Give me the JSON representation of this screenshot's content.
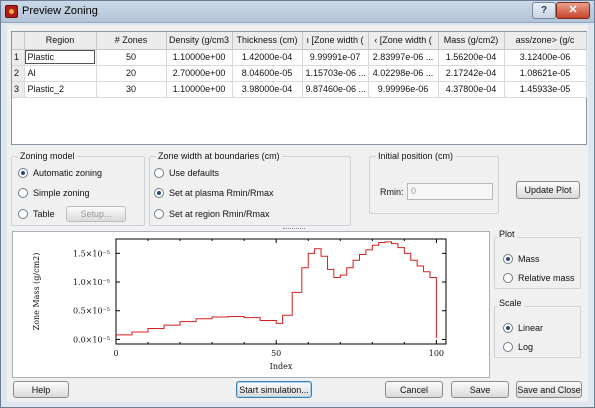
{
  "window": {
    "title": "Preview Zoning",
    "help_label": "?",
    "close_label": "✕"
  },
  "table": {
    "columns": [
      "Region",
      "# Zones",
      "Density (g/cm3)",
      "Thickness (cm)",
      "Min [Zone width (cm)]",
      "Max [Zone width (cm)]",
      "Mass (g/cm2)",
      "Mass/zone> (g/cm2)"
    ],
    "column_display": [
      "Region",
      "# Zones",
      "Density (g/cm3",
      "Thickness (cm)",
      "ı [Zone width (",
      "‹ [Zone width (",
      "Mass (g/cm2)",
      "ass/zone> (g/c"
    ],
    "rows": [
      {
        "index": "1",
        "cells": [
          "Plastic",
          "50",
          "1.10000e+00",
          "1.42000e-04",
          "9.99991e-07",
          "2.83997e-06 ...",
          "1.56200e-04",
          "3.12400e-06"
        ]
      },
      {
        "index": "2",
        "cells": [
          "Al",
          "20",
          "2.70000e+00",
          "8.04600e-05",
          "1.15703e-06 ...",
          "4.02298e-06 ...",
          "2.17242e-04",
          "1.08621e-05"
        ]
      },
      {
        "index": "3",
        "cells": [
          "Plastic_2",
          "30",
          "1.10000e+00",
          "3.98000e-04",
          "9.87460e-06 ...",
          "9.99996e-06",
          "4.37800e-04",
          "1.45933e-05"
        ]
      }
    ]
  },
  "zoning_model": {
    "label": "Zoning model",
    "options": [
      "Automatic zoning",
      "Simple zoning",
      "Table"
    ],
    "selected": "Automatic zoning",
    "setup_label": "Setup..."
  },
  "zone_width": {
    "label": "Zone width at boundaries (cm)",
    "options": [
      "Use defaults",
      "Set at plasma Rmin/Rmax",
      "Set at region Rmin/Rmax"
    ],
    "selected": "Set at plasma Rmin/Rmax"
  },
  "initial_position": {
    "label": "Initial position (cm)",
    "rmin_label": "Rmin:",
    "rmin_value": "0"
  },
  "update_plot_label": "Update Plot",
  "plot_panel": {
    "label": "Plot",
    "options": [
      "Mass",
      "Relative mass"
    ],
    "selected": "Mass"
  },
  "scale_panel": {
    "label": "Scale",
    "options": [
      "Linear",
      "Log"
    ],
    "selected": "Linear"
  },
  "buttons": {
    "help": "Help",
    "start": "Start simulation...",
    "cancel": "Cancel",
    "save": "Save",
    "save_close": "Save and Close"
  },
  "chart_data": {
    "type": "line",
    "xlabel": "Index",
    "ylabel": "Zone Mass (g/cm2)",
    "xlim": [
      0,
      103
    ],
    "ylim": [
      -8e-07,
      1.75e-05
    ],
    "xticks": [
      0,
      50,
      100
    ],
    "yticks": [
      0.0,
      5e-06,
      1e-05,
      1.5e-05
    ],
    "ytick_labels": [
      "0.0×10⁻⁵",
      "0.5×10⁻⁵",
      "1.0×10⁻⁵",
      "1.5×10⁻⁵"
    ],
    "line_color": "#d42020",
    "series": [
      {
        "step": true,
        "x": [
          0,
          5,
          10,
          15,
          20,
          25,
          30,
          35,
          40,
          45,
          50,
          52,
          55,
          58,
          60,
          62,
          64,
          66,
          68,
          70,
          72,
          74,
          76,
          78,
          80,
          82,
          84,
          86,
          88,
          90,
          92,
          94,
          96,
          98,
          100
        ],
        "y": [
          8e-07,
          1.3e-06,
          1.9e-06,
          2.5e-06,
          3.1e-06,
          3.6e-06,
          3.9e-06,
          4e-06,
          3.8e-06,
          3.3e-06,
          2.8e-06,
          4.2e-06,
          8.2e-06,
          1.25e-05,
          1.5e-05,
          1.58e-05,
          1.45e-05,
          1.22e-05,
          1.08e-05,
          1.12e-05,
          1.25e-05,
          1.38e-05,
          1.48e-05,
          1.56e-05,
          1.64e-05,
          1.69e-05,
          1.7e-05,
          1.67e-05,
          1.6e-05,
          1.5e-05,
          1.38e-05,
          1.28e-05,
          1.18e-05,
          1.08e-05,
          2e-07
        ]
      }
    ]
  }
}
